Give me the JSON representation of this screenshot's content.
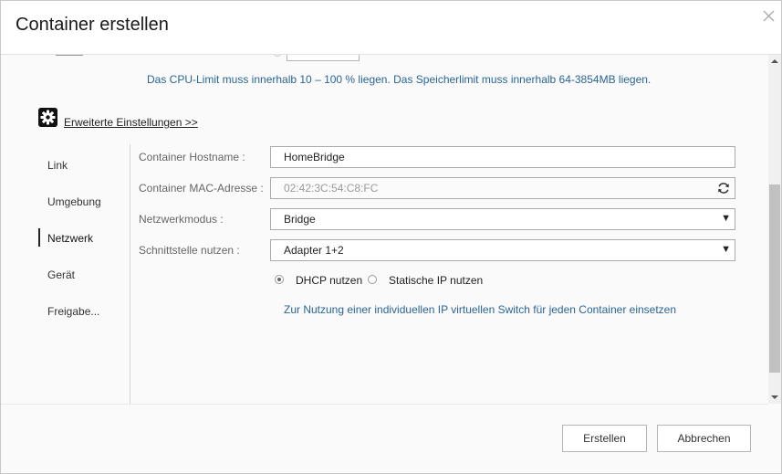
{
  "dialog": {
    "title": "Container erstellen"
  },
  "messages": {
    "limit": "Das CPU-Limit muss innerhalb 10 – 100 % liegen. Das Speicherlimit muss innerhalb 64-3854MB liegen."
  },
  "advanced": {
    "link_label": "Erweiterte Einstellungen >>",
    "icon": "gear-icon"
  },
  "sidebar": {
    "items": [
      {
        "label": "Link",
        "active": false
      },
      {
        "label": "Umgebung",
        "active": false
      },
      {
        "label": "Netzwerk",
        "active": true
      },
      {
        "label": "Gerät",
        "active": false
      },
      {
        "label": "Freigabe...",
        "active": false
      }
    ]
  },
  "network": {
    "hostname_label": "Container Hostname :",
    "hostname_value": "HomeBridge",
    "mac_label": "Container MAC-Adresse :",
    "mac_value": "02:42:3C:54:C8:FC",
    "mode_label": "Netzwerkmodus :",
    "mode_value": "Bridge",
    "interface_label": "Schnittstelle nutzen :",
    "interface_value": "Adapter 1+2",
    "dhcp_label": "DHCP nutzen",
    "static_label": "Statische IP nutzen",
    "ip_mode_selected": "DHCP nutzen",
    "vswitch_link": "Zur Nutzung einer individuellen IP virtuellen Switch für jeden Container einsetzen"
  },
  "footer": {
    "create_label": "Erstellen",
    "cancel_label": "Abbrechen"
  },
  "colors": {
    "link_blue": "#2a6496",
    "border": "#aaaaaa",
    "scroll_thumb": "#c1c1c1"
  }
}
